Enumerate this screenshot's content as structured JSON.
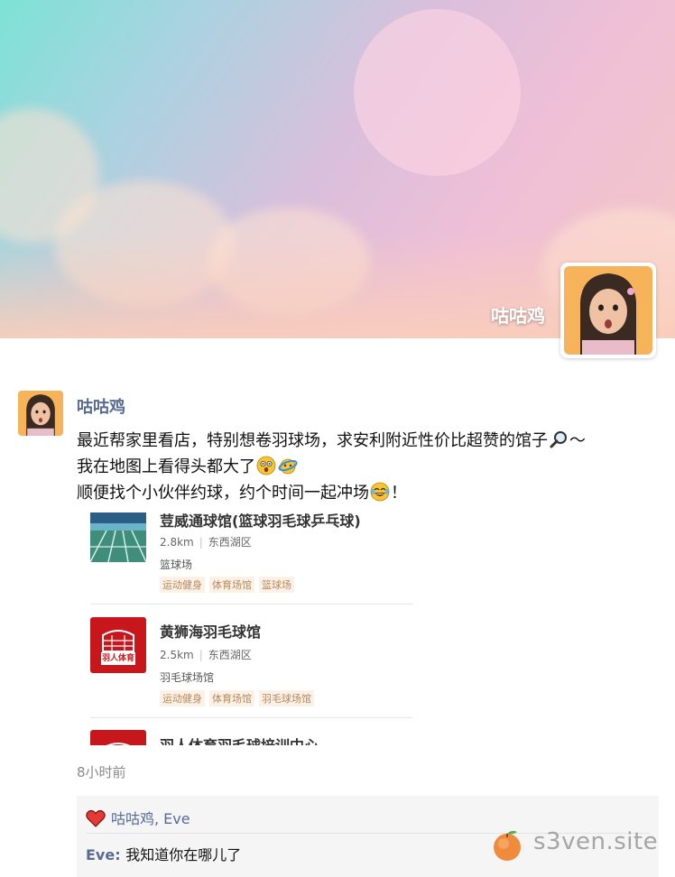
{
  "profile": {
    "name": "咕咕鸡"
  },
  "post": {
    "author": "咕咕鸡",
    "line1": "最近帮家里看店，特别想卷羽球场，求安利附近性价比超赞的馆子",
    "line1_tail": "～",
    "line2": "我在地图上看得头都大了",
    "line3": "顺便找个小伙伴约球，约个时间一起冲场",
    "line3_tail": "！",
    "emojis": [
      "magnifier-emoji",
      "astonished-emoji",
      "dizzy-emoji",
      "tears-of-joy-emoji"
    ],
    "time": "8小时前"
  },
  "shared_map": {
    "items": [
      {
        "title": "荳威通球馆(篮球羽毛球乒乓球)",
        "distance": "2.8km",
        "area": "东西湖区",
        "category": "篮球场",
        "tags": [
          "运动健身",
          "体育场馆",
          "篮球场"
        ],
        "thumb": "basketball-court-photo"
      },
      {
        "title": "黄狮海羽毛球馆",
        "distance": "2.5km",
        "area": "东西湖区",
        "category": "羽毛球场馆",
        "tags": [
          "运动健身",
          "体育场馆",
          "羽毛球场馆"
        ],
        "thumb": "yuren-sports-logo",
        "logo_text": "羽人体育"
      },
      {
        "title": "羽人体育羽毛球培训中心",
        "thumb": "yuren-sports-logo"
      }
    ],
    "separator": "|"
  },
  "interactions": {
    "likes": "咕咕鸡, Eve",
    "comments": [
      {
        "author": "Eve",
        "sep": ": ",
        "text": "我知道你在哪儿了"
      }
    ]
  },
  "watermark": {
    "text": "s3ven.site",
    "icon": "peach-icon"
  },
  "colors": {
    "link_blue": "#576b95",
    "tag_text": "#b8885a",
    "tag_bg": "#fbf1e6",
    "logo_red": "#c8161d"
  }
}
